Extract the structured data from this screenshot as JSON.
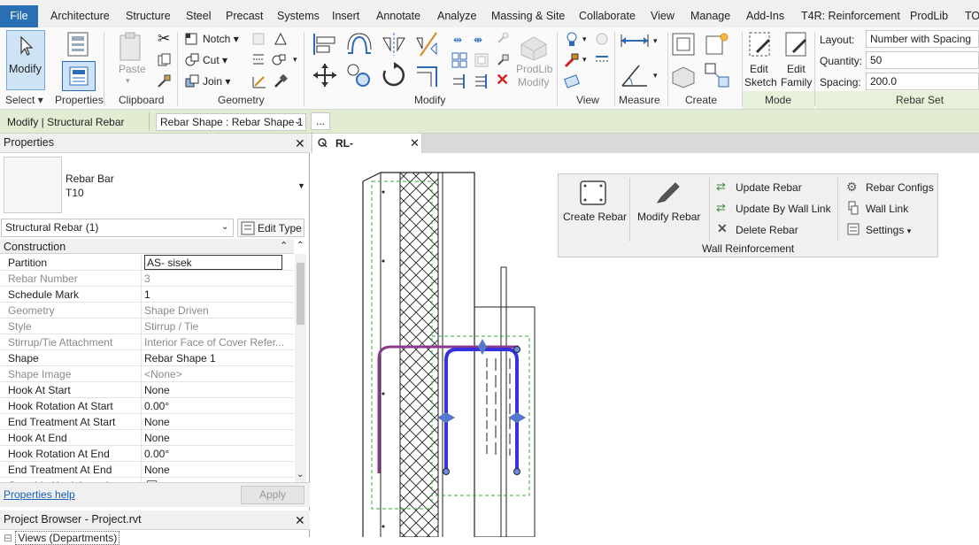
{
  "tabs": [
    "File",
    "Architecture",
    "Structure",
    "Steel",
    "Precast",
    "Systems",
    "Insert",
    "Annotate",
    "Analyze",
    "Massing & Site",
    "Collaborate",
    "View",
    "Manage",
    "Add-Ins",
    "T4R: Reinforcement",
    "ProdLib",
    "TO"
  ],
  "ribbon": {
    "modify_label": "Modify",
    "paste_label": "Paste",
    "notch_label": "Notch",
    "cut_label": "Cut",
    "join_label": "Join",
    "prodlib_modify_label_1": "ProdLib",
    "prodlib_modify_label_2": "Modify",
    "edit_sketch_1": "Edit",
    "edit_sketch_2": "Sketch",
    "edit_family_1": "Edit",
    "edit_family_2": "Family",
    "layout_label": "Layout:",
    "layout_value": "Number with Spacing",
    "quantity_label": "Quantity:",
    "quantity_value": "50",
    "spacing_label": "Spacing:",
    "spacing_value": "200.0",
    "panels": [
      "Select",
      "Properties",
      "Clipboard",
      "Geometry",
      "Modify",
      "View",
      "Measure",
      "Create",
      "Mode",
      "Rebar Set"
    ]
  },
  "optionbar": {
    "context": "Modify | Structural Rebar",
    "shape_select": "Rebar Shape : Rebar Shape 1",
    "more": "..."
  },
  "properties": {
    "title": "Properties",
    "type_name_1": "Rebar Bar",
    "type_name_2": "T10",
    "filter": "Structural Rebar (1)",
    "edit_type": "Edit Type",
    "group": "Construction",
    "rows": [
      {
        "k": "Partition",
        "v": "AS- sisek",
        "editable": true
      },
      {
        "k": "Rebar Number",
        "v": "3",
        "editable": false
      },
      {
        "k": "Schedule Mark",
        "v": "1",
        "editable": true
      },
      {
        "k": "Geometry",
        "v": "Shape Driven",
        "editable": false
      },
      {
        "k": "Style",
        "v": "Stirrup / Tie",
        "editable": false
      },
      {
        "k": "Stirrup/Tie Attachment",
        "v": "Interior Face of Cover Refer...",
        "editable": false
      },
      {
        "k": "Shape",
        "v": "Rebar Shape 1",
        "editable": true
      },
      {
        "k": "Shape Image",
        "v": "<None>",
        "editable": false
      },
      {
        "k": "Hook At Start",
        "v": "None",
        "editable": true
      },
      {
        "k": "Hook Rotation At Start",
        "v": "0.00°",
        "editable": true
      },
      {
        "k": "End Treatment At Start",
        "v": "None",
        "editable": true
      },
      {
        "k": "Hook At End",
        "v": "None",
        "editable": true
      },
      {
        "k": "Hook Rotation At End",
        "v": "0.00°",
        "editable": true
      },
      {
        "k": "End Treatment At End",
        "v": "None",
        "editable": true
      },
      {
        "k": "Override Hook Lengths",
        "v": "",
        "editable": true
      }
    ],
    "help": "Properties help",
    "apply": "Apply"
  },
  "project_browser": {
    "title": "Project Browser - Project.rvt",
    "first_item": "Views (Departments)"
  },
  "view_tab": "RL-",
  "wall_panel": {
    "create_rebar": "Create Rebar",
    "modify_rebar": "Modify Rebar",
    "update_rebar": "Update Rebar",
    "update_by_wall_link": "Update By Wall Link",
    "delete_rebar": "Delete Rebar",
    "rebar_configs": "Rebar Configs",
    "wall_link": "Wall Link",
    "settings": "Settings",
    "title": "Wall Reinforcement"
  }
}
